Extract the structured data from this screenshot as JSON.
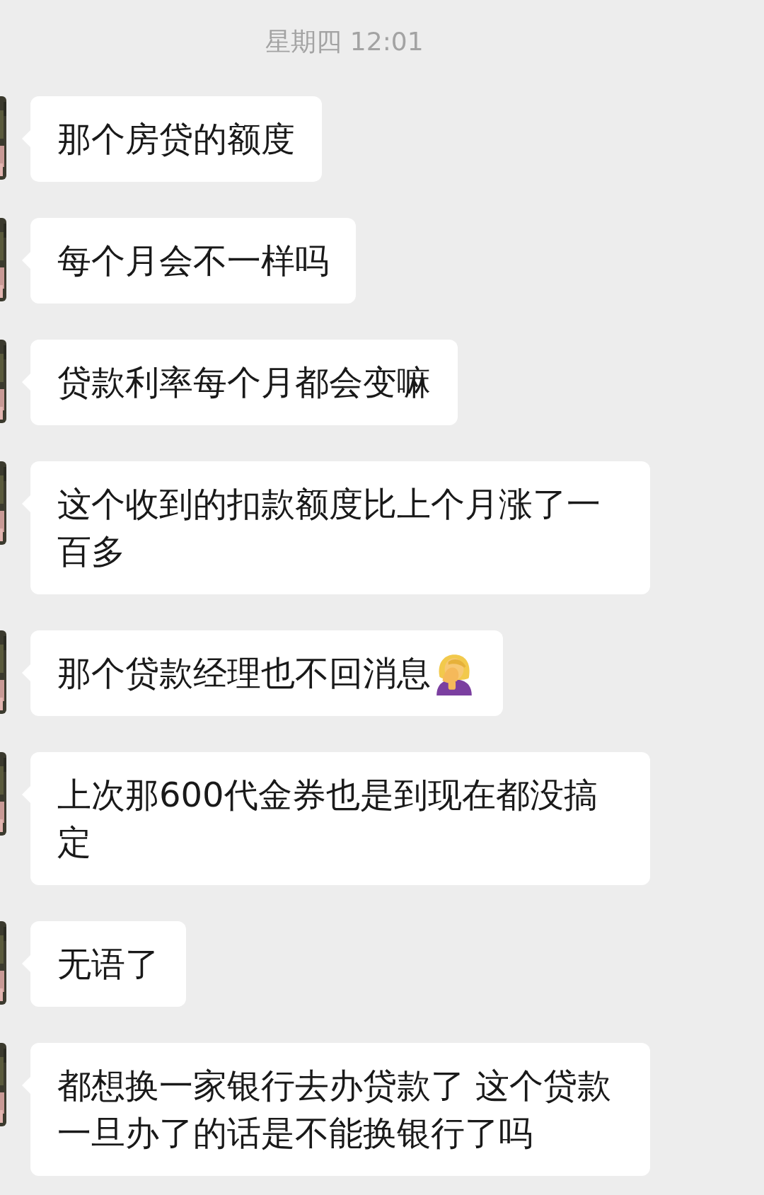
{
  "timestamp": "星期四 12:01",
  "messages": [
    {
      "kind": "plain",
      "text": "那个房贷的额度"
    },
    {
      "kind": "plain",
      "text": "每个月会不一样吗"
    },
    {
      "kind": "plain",
      "text": "贷款利率每个月都会变嘛"
    },
    {
      "kind": "plain",
      "text": "这个收到的扣款额度比上个月涨了一百多"
    },
    {
      "kind": "facepalm",
      "text": "那个贷款经理也不回消息"
    },
    {
      "kind": "plain",
      "text": "上次那600代金券也是到现在都没搞定"
    },
    {
      "kind": "plain",
      "text": "无语了"
    },
    {
      "kind": "plain",
      "text": "都想换一家银行去办贷款了 这个贷款一旦办了的话是不能换银行了吗"
    }
  ]
}
